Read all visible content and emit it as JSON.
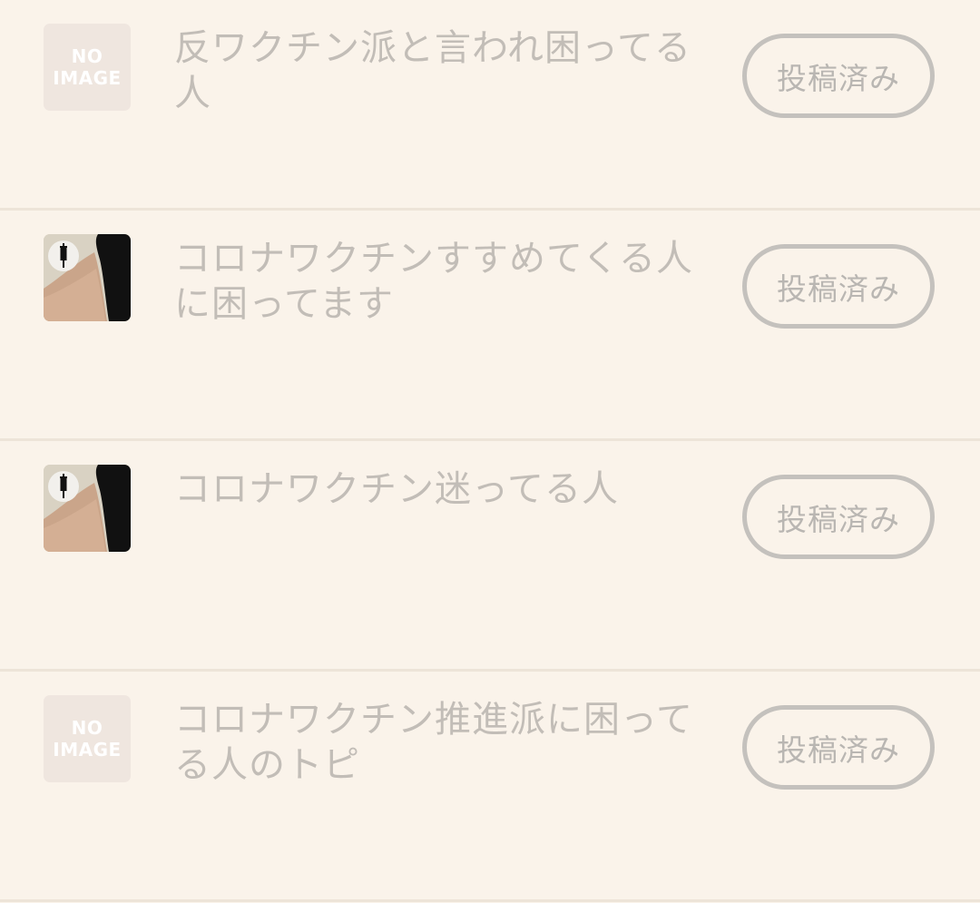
{
  "topics": [
    {
      "thumbnail": "no-image",
      "no_image_line1": "NO",
      "no_image_line2": "IMAGE",
      "title": "反ワクチン派と言われ困ってる人",
      "status_button": "投稿済み"
    },
    {
      "thumbnail": "syringe-photo",
      "title": "コロナワクチンすすめてくる人に困ってます",
      "status_button": "投稿済み"
    },
    {
      "thumbnail": "syringe-photo",
      "title": "コロナワクチン迷ってる人",
      "status_button": "投稿済み"
    },
    {
      "thumbnail": "no-image",
      "no_image_line1": "NO",
      "no_image_line2": "IMAGE",
      "title": " コロナワクチン推進派に困ってる人のトピ",
      "status_button": "投稿済み"
    }
  ],
  "colors": {
    "background": "#faf3ea",
    "divider": "#ede4d8",
    "text_muted": "#c2bdb7",
    "button_border": "#c4c1bd"
  }
}
